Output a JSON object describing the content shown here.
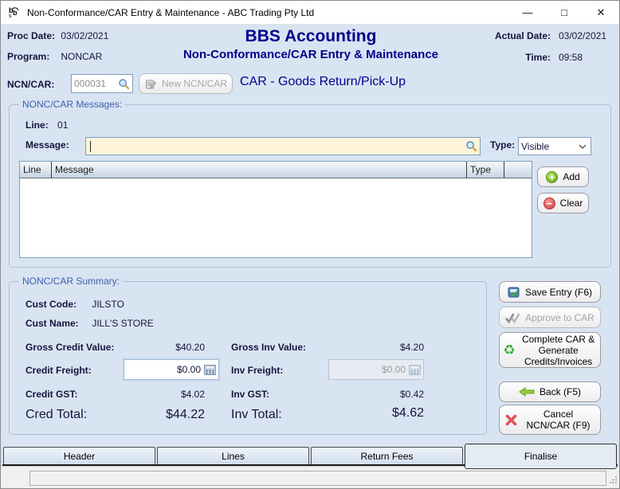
{
  "window": {
    "title": "Non-Conformance/CAR Entry & Maintenance - ABC Trading Pty Ltd",
    "controls": {
      "minimize": "—",
      "maximize": "□",
      "close": "✕"
    }
  },
  "header": {
    "proc_date_label": "Proc Date:",
    "proc_date_value": "03/02/2021",
    "program_label": "Program:",
    "program_value": "NONCAR",
    "app_title": "BBS Accounting",
    "app_subtitle": "Non-Conformance/CAR Entry & Maintenance",
    "actual_date_label": "Actual Date:",
    "actual_date_value": "03/02/2021",
    "time_label": "Time:",
    "time_value": "09:58"
  },
  "ncn_bar": {
    "label": "NCN/CAR:",
    "number": "000031",
    "new_button_label": "New NCN/CAR",
    "mode_title": "CAR - Goods Return/Pick-Up"
  },
  "messages": {
    "group_title": "NONC/CAR Messages:",
    "line_label": "Line:",
    "line_value": "01",
    "message_label": "Message:",
    "message_value": "",
    "type_label": "Type:",
    "type_selected": "Visible",
    "table_columns": [
      "Line",
      "Message",
      "Type"
    ],
    "table_rows": [],
    "add_label": "Add",
    "clear_label": "Clear"
  },
  "summary": {
    "group_title": "NONC/CAR Summary:",
    "cust_code_label": "Cust Code:",
    "cust_code_value": "JILSTO",
    "cust_name_label": "Cust Name:",
    "cust_name_value": "JILL'S STORE",
    "credit": {
      "gross_label": "Gross Credit Value:",
      "gross_value": "$40.20",
      "freight_label": "Credit Freight:",
      "freight_value": "$0.00",
      "gst_label": "Credit GST:",
      "gst_value": "$4.02",
      "total_label": "Cred Total:",
      "total_value": "$44.22"
    },
    "invoice": {
      "gross_label": "Gross Inv Value:",
      "gross_value": "$4.20",
      "freight_label": "Inv Freight:",
      "freight_value": "$0.00",
      "gst_label": "Inv GST:",
      "gst_value": "$0.42",
      "total_label": "Inv Total:",
      "total_value": "$4.62"
    }
  },
  "actions": {
    "save_label": "Save Entry (F6)",
    "approve_label": "Approve to CAR",
    "complete_label": "Complete CAR & Generate Credits/Invoices",
    "back_label": "Back (F5)",
    "cancel_label": "Cancel NCN/CAR (F9)"
  },
  "tabs": [
    {
      "label": "Header",
      "active": false
    },
    {
      "label": "Lines",
      "active": false
    },
    {
      "label": "Return Fees",
      "active": false
    },
    {
      "label": "Finalise",
      "active": true
    }
  ],
  "colors": {
    "window_bg": "#d9e4f2",
    "title_navy": "#00008b",
    "group_label_blue": "#3c5fae",
    "message_field_cream": "#fdf4da",
    "add_green": "#5ba80f",
    "clear_red": "#d23b3b",
    "cancel_red": "#e05555",
    "back_green": "#9ccc3c"
  }
}
